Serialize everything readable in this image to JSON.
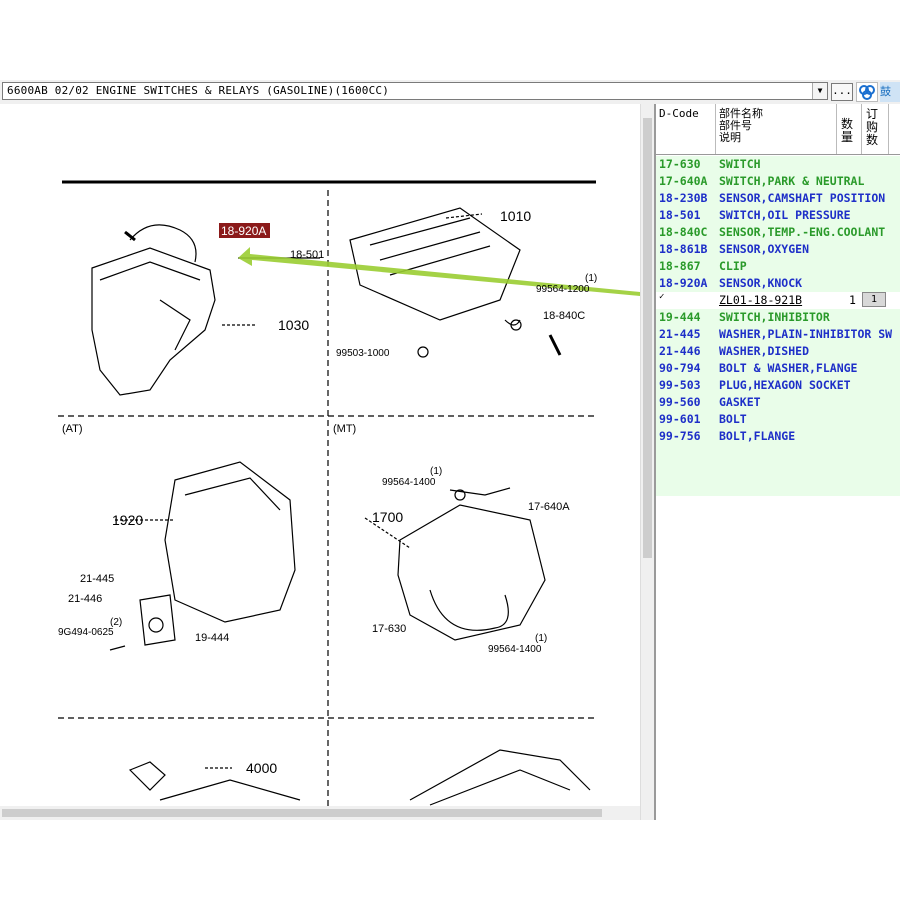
{
  "toolbar": {
    "title_combo": "6600AB 02/02 ENGINE SWITCHES & RELAYS (GASOLINE)(1600CC)",
    "browse_label": "...",
    "cut_label": "鼓"
  },
  "diagram": {
    "highlight_callout": "18-920A",
    "callouts": [
      "1010",
      "18-501",
      "1030",
      "99564-1200",
      "(1)",
      "18-840C",
      "99503-1000",
      "(AT)",
      "(MT)",
      "99564-1400",
      "(1)",
      "17-640A",
      "1920",
      "1700",
      "21-445",
      "21-446",
      "(2)",
      "9G494-0625",
      "19-444",
      "17-630",
      "99564-1400",
      "(1)",
      "4000"
    ]
  },
  "parts": {
    "headers": {
      "dcode": "D-Code",
      "name_line1": "部件名称",
      "name_line2": "部件号",
      "name_line3": "说明",
      "qty": "数量",
      "order": "订购数"
    },
    "rows": [
      {
        "code": "17-630",
        "name": "SWITCH",
        "color": "green"
      },
      {
        "code": "17-640A",
        "name": "SWITCH,PARK & NEUTRAL",
        "color": "green"
      },
      {
        "code": "18-230B",
        "name": "SENSOR,CAMSHAFT POSITION",
        "color": "blue"
      },
      {
        "code": "18-501",
        "name": "SWITCH,OIL PRESSURE",
        "color": "blue"
      },
      {
        "code": "18-840C",
        "name": "SENSOR,TEMP.-ENG.COOLANT",
        "color": "green"
      },
      {
        "code": "18-861B",
        "name": "SENSOR,OXYGEN",
        "color": "blue"
      },
      {
        "code": "18-867",
        "name": "CLIP",
        "color": "green"
      },
      {
        "code": "18-920A",
        "name": "SENSOR,KNOCK",
        "color": "blue"
      }
    ],
    "selected_part": {
      "checkbox": "✓",
      "part_no": "ZL01-18-921B",
      "qty": "1",
      "order": "1"
    },
    "rows2": [
      {
        "code": "19-444",
        "name": "SWITCH,INHIBITOR",
        "color": "green"
      },
      {
        "code": "21-445",
        "name": "WASHER,PLAIN-INHIBITOR SW",
        "color": "blue"
      },
      {
        "code": "21-446",
        "name": "WASHER,DISHED",
        "color": "blue"
      },
      {
        "code": "90-794",
        "name": "BOLT & WASHER,FLANGE",
        "color": "blue"
      },
      {
        "code": "99-503",
        "name": "PLUG,HEXAGON SOCKET",
        "color": "blue"
      },
      {
        "code": "99-560",
        "name": "GASKET",
        "color": "blue"
      },
      {
        "code": "99-601",
        "name": "BOLT",
        "color": "blue"
      },
      {
        "code": "99-756",
        "name": "BOLT,FLANGE",
        "color": "blue"
      }
    ]
  }
}
